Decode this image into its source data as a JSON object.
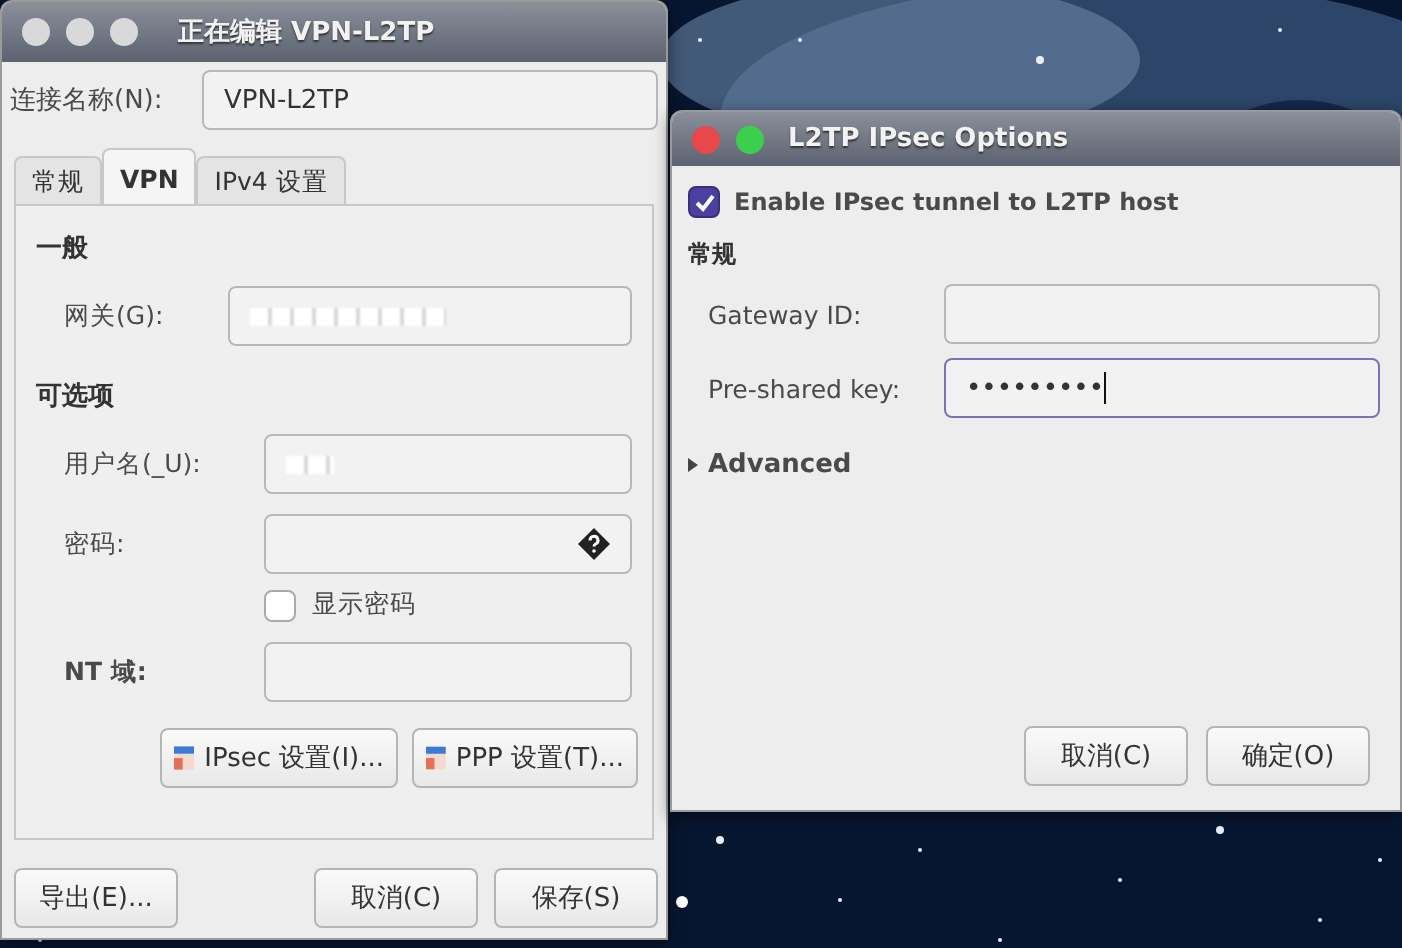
{
  "editor_window": {
    "title": "正在编辑 VPN-L2TP",
    "window_controls": [
      {
        "color": "#d9d9d9"
      },
      {
        "color": "#d9d9d9"
      },
      {
        "color": "#d9d9d9"
      }
    ],
    "connection_name": {
      "label": "连接名称(N):",
      "value": "VPN-L2TP"
    },
    "tabs": [
      {
        "label": "常规",
        "selected": false
      },
      {
        "label": "VPN",
        "selected": true
      },
      {
        "label": "IPv4 设置",
        "selected": false
      }
    ],
    "general_heading": "一般",
    "gateway": {
      "label": "网关(G):",
      "redacted": true
    },
    "optional_heading": "可选项",
    "username": {
      "label": "用户名(_U):",
      "redacted": true
    },
    "password": {
      "label": "密码:"
    },
    "show_password": {
      "label": "显示密码",
      "checked": false
    },
    "nt_domain": {
      "label": "NT 域:"
    },
    "settings_buttons": [
      "IPsec 设置(I)...",
      "PPP 设置(T)..."
    ],
    "export_button": "导出(E)...",
    "footer_buttons": [
      "取消(C)",
      "保存(S)"
    ]
  },
  "ipsec_dialog": {
    "title": "L2TP IPsec Options",
    "window_controls": [
      {
        "color": "#e8474c"
      },
      {
        "color": "#3ccf4e"
      }
    ],
    "enable_ipsec": {
      "label": "Enable IPsec tunnel to L2TP host",
      "checked": true
    },
    "section_heading": "常规",
    "gateway_id": {
      "label": "Gateway ID:"
    },
    "pre_shared_key": {
      "label": "Pre-shared key:",
      "value": "•••••••••",
      "focused": true
    },
    "advanced": {
      "label": "Advanced",
      "expanded": false
    },
    "buttons": [
      "取消(C)",
      "确定(O)"
    ]
  }
}
